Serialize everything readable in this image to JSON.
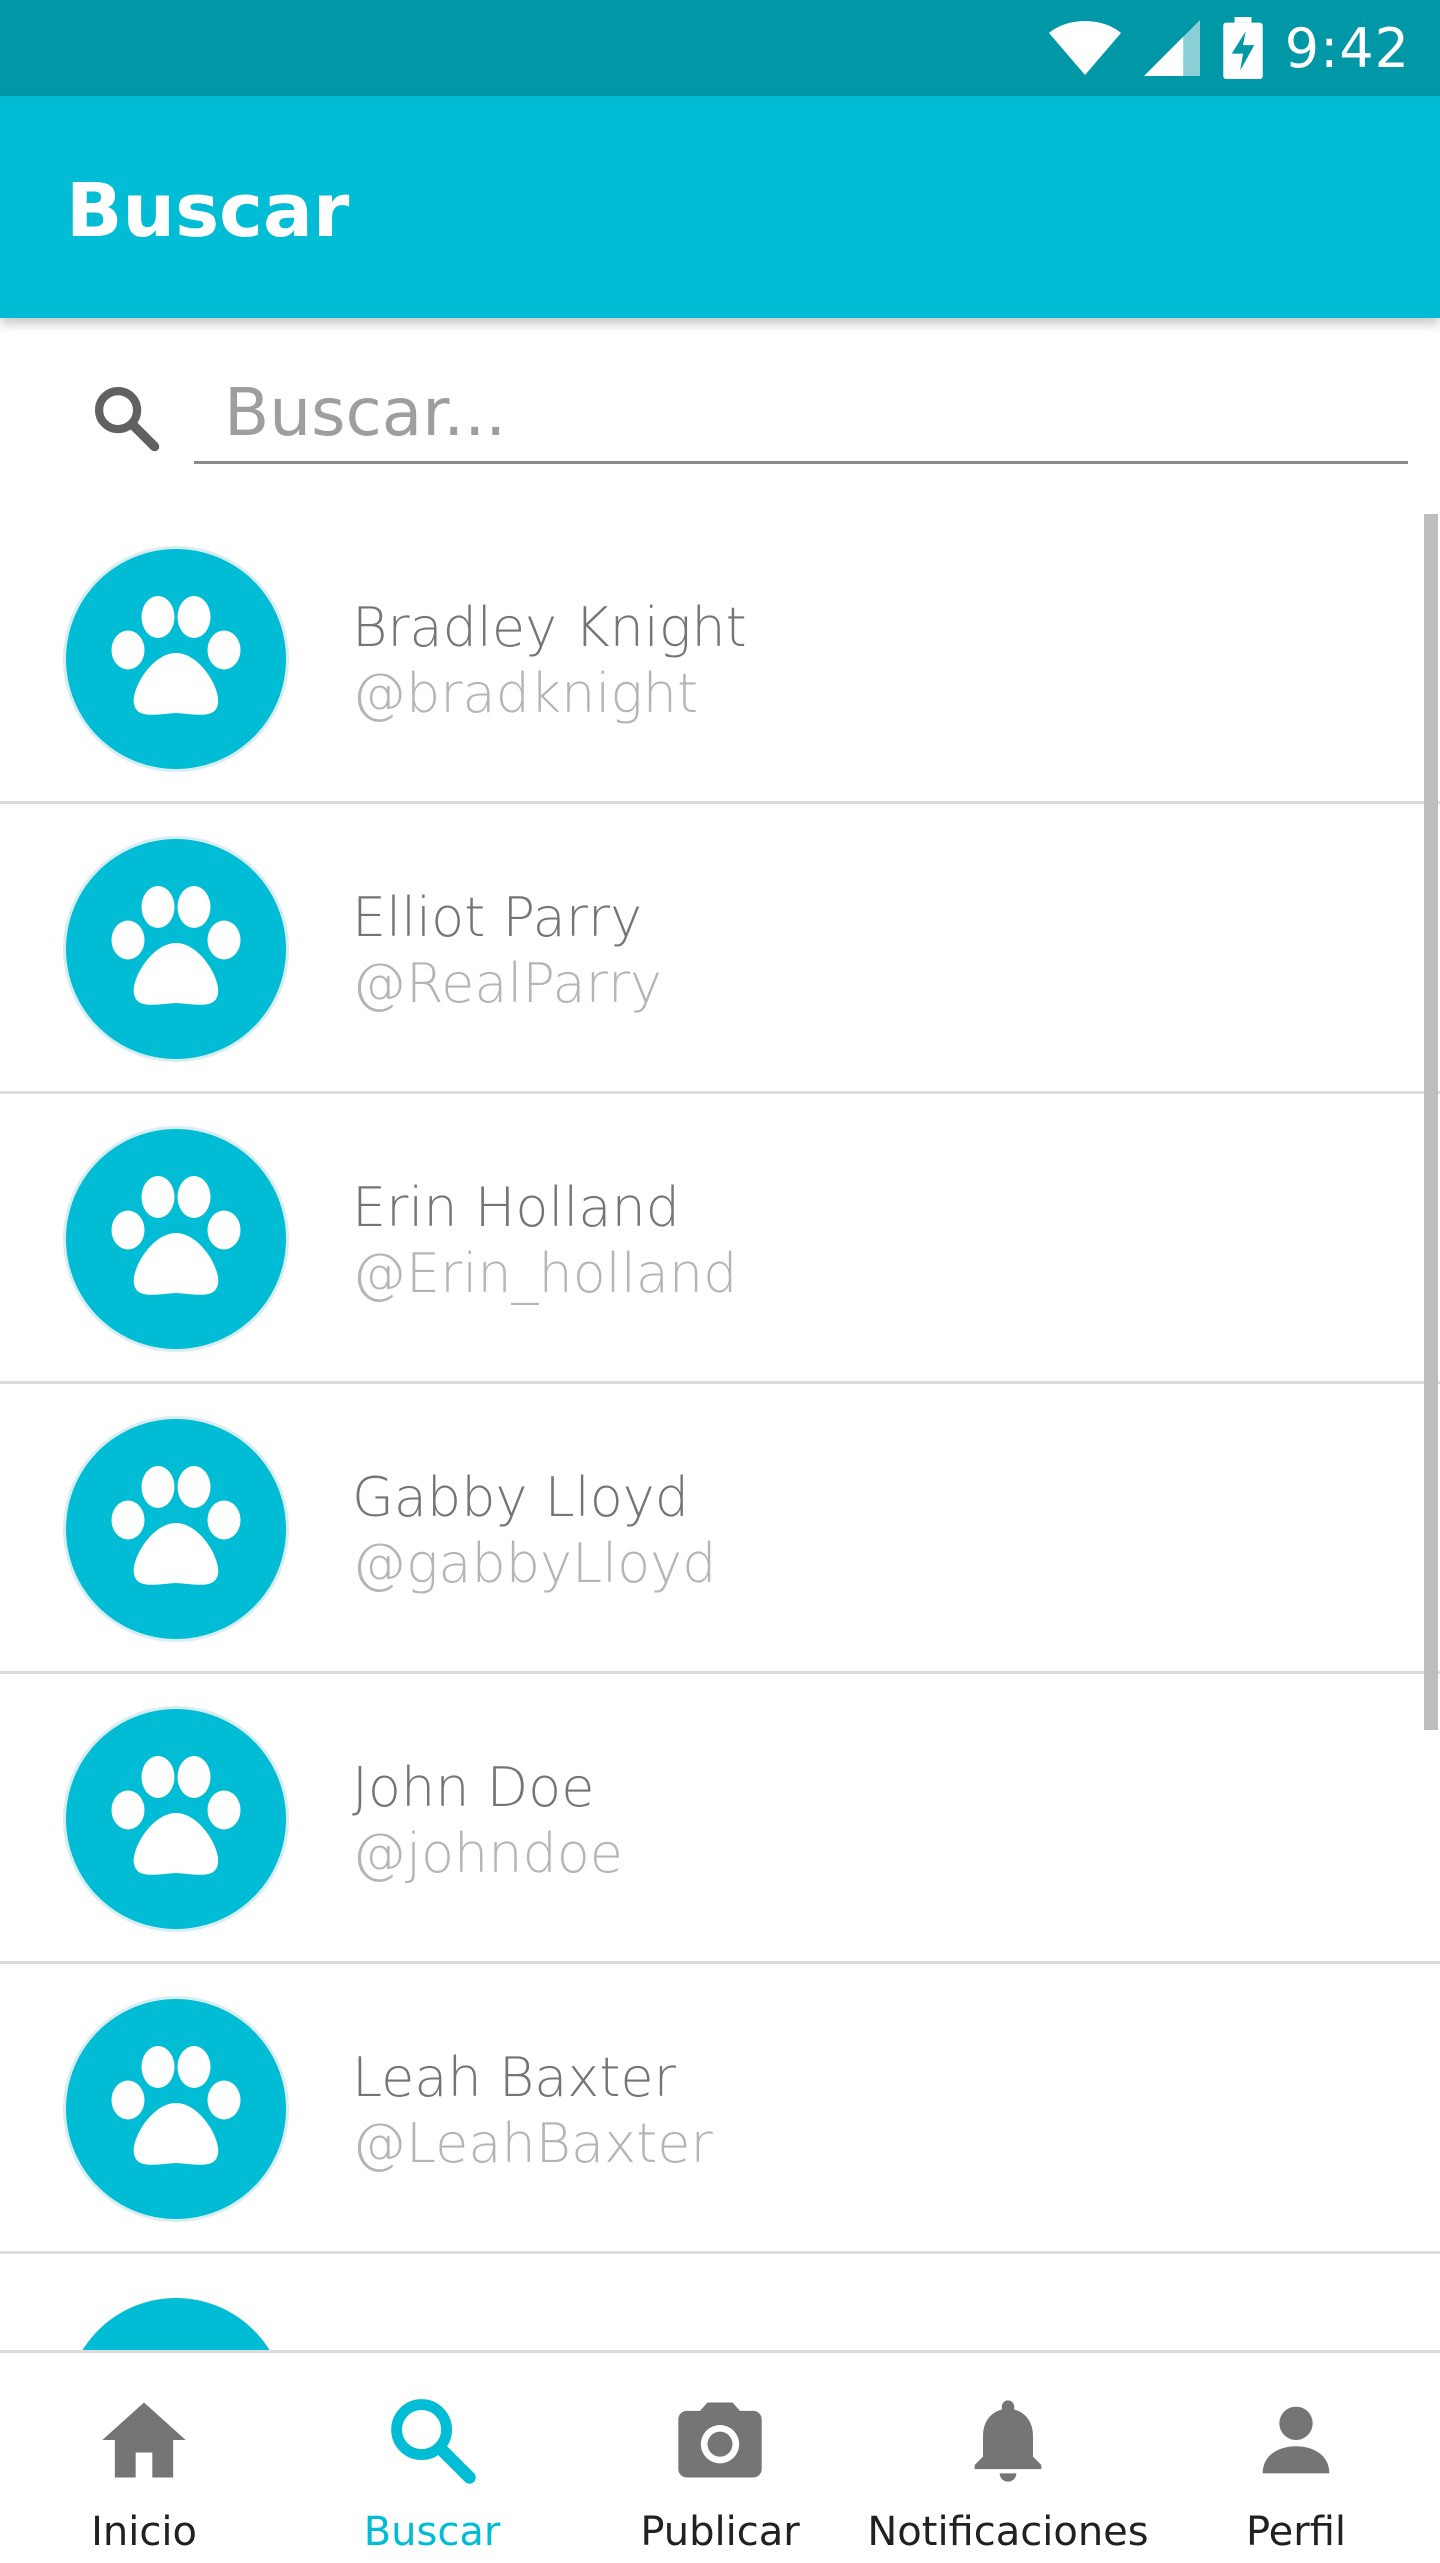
{
  "status_bar": {
    "time": "9:42"
  },
  "app_bar": {
    "title": "Buscar"
  },
  "search": {
    "placeholder": "Buscar...",
    "value": ""
  },
  "users": [
    {
      "name": "Bradley Knight",
      "handle": "@bradknight"
    },
    {
      "name": "Elliot Parry",
      "handle": "@RealParry"
    },
    {
      "name": "Erin Holland",
      "handle": "@Erin_holland"
    },
    {
      "name": "Gabby Lloyd",
      "handle": "@gabbyLloyd"
    },
    {
      "name": "John Doe",
      "handle": "@johndoe"
    },
    {
      "name": "Leah Baxter",
      "handle": "@LeahBaxter"
    }
  ],
  "bottom_nav": {
    "items": [
      {
        "label": "Inicio",
        "icon": "home-icon"
      },
      {
        "label": "Buscar",
        "icon": "search-icon",
        "active": true
      },
      {
        "label": "Publicar",
        "icon": "camera-icon"
      },
      {
        "label": "Notificaciones",
        "icon": "bell-icon"
      },
      {
        "label": "Perfil",
        "icon": "person-icon"
      }
    ]
  },
  "colors": {
    "primary": "#00bcd4",
    "primary_dark": "#0097a7",
    "text_primary": "#757575",
    "text_secondary": "#b5b5b5"
  }
}
